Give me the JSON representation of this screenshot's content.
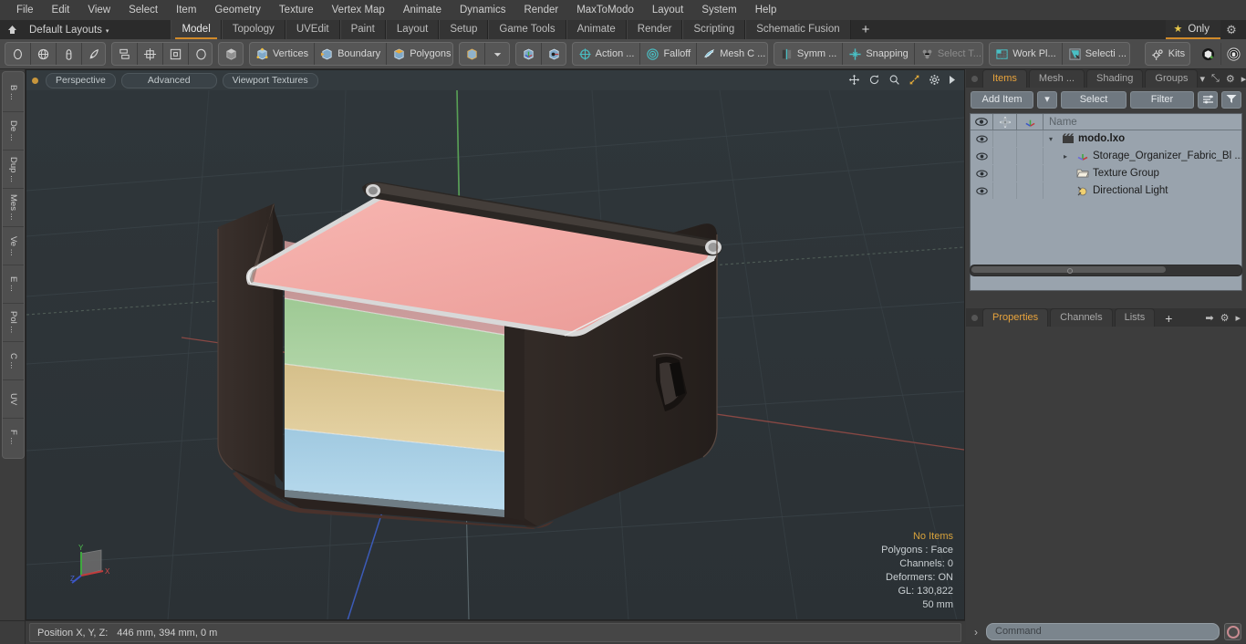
{
  "app": {
    "title": "modo"
  },
  "menubar": {
    "items": [
      "File",
      "Edit",
      "View",
      "Select",
      "Item",
      "Geometry",
      "Texture",
      "Vertex Map",
      "Animate",
      "Dynamics",
      "Render",
      "MaxToModo",
      "Layout",
      "System",
      "Help"
    ]
  },
  "layoutbar": {
    "home_icon": "home-icon",
    "layout_selector": "Default Layouts",
    "caret": "▾",
    "tabs": [
      {
        "label": "Model",
        "selected": true
      },
      {
        "label": "Topology",
        "selected": false
      },
      {
        "label": "UVEdit",
        "selected": false
      },
      {
        "label": "Paint",
        "selected": false
      },
      {
        "label": "Layout",
        "selected": false
      },
      {
        "label": "Setup",
        "selected": false
      },
      {
        "label": "Game Tools",
        "selected": false
      },
      {
        "label": "Animate",
        "selected": false
      },
      {
        "label": "Render",
        "selected": false
      },
      {
        "label": "Scripting",
        "selected": false
      },
      {
        "label": "Schematic Fusion",
        "selected": false
      }
    ],
    "add_tab": "+",
    "only_label": "Only",
    "only_star": "★",
    "gear": "⚙",
    "accent_color": "#d08a2a"
  },
  "toolbar": {
    "groups": [
      {
        "name": "primitives",
        "buttons": [
          {
            "icon": "ellipse-icon",
            "label": ""
          },
          {
            "icon": "sphere-icon",
            "label": ""
          },
          {
            "icon": "capsule-icon",
            "label": ""
          },
          {
            "icon": "teardrop-icon",
            "label": ""
          }
        ]
      },
      {
        "name": "arrange",
        "buttons": [
          {
            "icon": "align-icon",
            "label": ""
          },
          {
            "icon": "center-icon",
            "label": ""
          },
          {
            "icon": "square-icon",
            "label": ""
          },
          {
            "icon": "circle-icon",
            "label": ""
          }
        ]
      },
      {
        "name": "shade",
        "buttons": [
          {
            "icon": "cube-shaded-icon",
            "label": ""
          }
        ]
      },
      {
        "name": "components",
        "buttons": [
          {
            "icon": "vertices-icon",
            "label": "Vertices"
          },
          {
            "icon": "boundary-icon",
            "label": "Boundary"
          },
          {
            "icon": "polygons-icon",
            "label": "Polygons"
          }
        ]
      },
      {
        "name": "selection-mode",
        "buttons": [
          {
            "icon": "cube-icon",
            "label": ""
          },
          {
            "icon": "chevron-down-icon",
            "label": ""
          }
        ]
      },
      {
        "name": "axis-modes",
        "buttons": [
          {
            "icon": "axis-cube-a-icon",
            "label": ""
          },
          {
            "icon": "axis-cube-b-icon",
            "label": ""
          }
        ]
      },
      {
        "name": "action-center",
        "buttons": [
          {
            "icon": "action-center-icon",
            "label": "Action  ..."
          },
          {
            "icon": "falloff-icon",
            "label": "Falloff"
          },
          {
            "icon": "mesh-constraint-icon",
            "label": "Mesh C ..."
          }
        ]
      },
      {
        "name": "symmetry-snapping",
        "buttons": [
          {
            "icon": "symmetry-icon",
            "label": "Symm ..."
          },
          {
            "icon": "snapping-icon",
            "label": "Snapping"
          },
          {
            "icon": "select-through-icon",
            "label": "Select T...",
            "dim": true
          }
        ]
      },
      {
        "name": "workplane",
        "buttons": [
          {
            "icon": "work-plane-icon",
            "label": "Work Pl..."
          },
          {
            "icon": "selection-set-icon",
            "label": "Selecti  ..."
          }
        ]
      },
      {
        "name": "kits",
        "buttons": [
          {
            "icon": "kits-gear-icon",
            "label": "Kits"
          }
        ]
      },
      {
        "name": "plugins",
        "buttons": [
          {
            "icon": "modo-logo-icon",
            "label": ""
          },
          {
            "icon": "unreal-logo-icon",
            "label": ""
          }
        ]
      }
    ]
  },
  "left_tool_tabs": [
    {
      "label": "B ...",
      "name": "basic"
    },
    {
      "label": "De ...",
      "name": "deform"
    },
    {
      "label": "Dup ...",
      "name": "duplicate"
    },
    {
      "label": "Mes ...",
      "name": "mesh-edit"
    },
    {
      "label": "Ve ...",
      "name": "vertex"
    },
    {
      "label": "E ...",
      "name": "edge"
    },
    {
      "label": "Pol ...",
      "name": "polygon"
    },
    {
      "label": "C ...",
      "name": "curve"
    },
    {
      "label": "UV",
      "name": "uv"
    },
    {
      "label": "F ...",
      "name": "fusion"
    }
  ],
  "viewport": {
    "header_buttons": [
      "Perspective",
      "Advanced",
      "Viewport Textures"
    ],
    "header_icons": [
      "move-icon",
      "rotate-icon",
      "zoom-icon",
      "fit-icon",
      "gear-icon",
      "play-icon"
    ],
    "info": {
      "selection": "No Items",
      "mode": "Polygons : Face",
      "channels": "Channels: 0",
      "deformers": "Deformers: ON",
      "gl": "GL: 130,822",
      "grid": "50 mm"
    },
    "axis_gizmo": {
      "x": "X",
      "y": "Y",
      "z": "Z"
    },
    "background_color": "#2d3438",
    "model": {
      "name": "storage-organizer-fabric-bin",
      "body_color": "#2e2724",
      "lid_color": "#f2a8a4",
      "rim_color": "#d8d8d8",
      "stripes": [
        "#c49090",
        "#a9cf9f",
        "#ddc894",
        "#a8d0e4"
      ]
    }
  },
  "right_panel": {
    "top_tabs": [
      {
        "label": "Items",
        "selected": true
      },
      {
        "label": "Mesh ...",
        "selected": false
      },
      {
        "label": "Shading",
        "selected": false
      },
      {
        "label": "Groups",
        "selected": false
      }
    ],
    "top_tabs_extra": [
      "▾",
      "⤡",
      "⚙",
      "▸"
    ],
    "toolrow": {
      "add_item": "Add Item",
      "add_item_caret": "▾",
      "select": "Select",
      "filter": "Filter",
      "list_icon": "list-icon",
      "funnel_icon": "funnel-icon"
    },
    "list_headers": {
      "eye": "eye-icon",
      "lock": "lock-icon",
      "axis": "axis-icon",
      "name": "Name"
    },
    "items": [
      {
        "label": "modo.lxo",
        "icon": "scene-icon",
        "indent": 0,
        "bold": true,
        "expander": "▾"
      },
      {
        "label": "Storage_Organizer_Fabric_Bl ...",
        "icon": "mesh-icon",
        "indent": 1,
        "bold": false,
        "expander": "▸"
      },
      {
        "label": "Texture Group",
        "icon": "folder-icon",
        "indent": 1,
        "bold": false,
        "expander": ""
      },
      {
        "label": "Directional Light",
        "icon": "light-icon",
        "indent": 1,
        "bold": false,
        "expander": ""
      }
    ],
    "bottom_tabs": [
      {
        "label": "Properties",
        "selected": true
      },
      {
        "label": "Channels",
        "selected": false
      },
      {
        "label": "Lists",
        "selected": false
      }
    ],
    "bottom_tabs_plus": "+"
  },
  "statusbar": {
    "label": "Position X, Y, Z:",
    "value": "446 mm, 394 mm, 0 m"
  },
  "commandbar": {
    "prompt": "›",
    "placeholder": "Command",
    "record_icon": "record-icon"
  }
}
